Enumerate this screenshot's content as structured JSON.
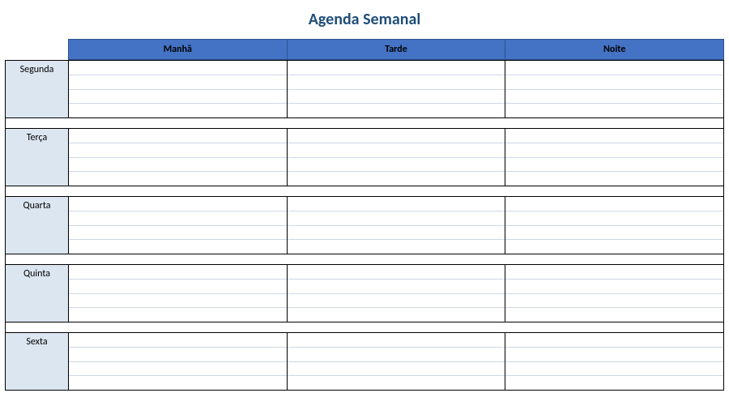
{
  "title": "Agenda Semanal",
  "columns": [
    "Manhã",
    "Tarde",
    "Noite"
  ],
  "days": [
    {
      "name": "Segunda",
      "slots": [
        [
          "",
          "",
          ""
        ],
        [
          "",
          "",
          ""
        ],
        [
          "",
          "",
          ""
        ],
        [
          "",
          "",
          ""
        ]
      ]
    },
    {
      "name": "Terça",
      "slots": [
        [
          "",
          "",
          ""
        ],
        [
          "",
          "",
          ""
        ],
        [
          "",
          "",
          ""
        ],
        [
          "",
          "",
          ""
        ]
      ]
    },
    {
      "name": "Quarta",
      "slots": [
        [
          "",
          "",
          ""
        ],
        [
          "",
          "",
          ""
        ],
        [
          "",
          "",
          ""
        ],
        [
          "",
          "",
          ""
        ]
      ]
    },
    {
      "name": "Quinta",
      "slots": [
        [
          "",
          "",
          ""
        ],
        [
          "",
          "",
          ""
        ],
        [
          "",
          "",
          ""
        ],
        [
          "",
          "",
          ""
        ]
      ]
    },
    {
      "name": "Sexta",
      "slots": [
        [
          "",
          "",
          ""
        ],
        [
          "",
          "",
          ""
        ],
        [
          "",
          "",
          ""
        ],
        [
          "",
          "",
          ""
        ]
      ]
    }
  ]
}
